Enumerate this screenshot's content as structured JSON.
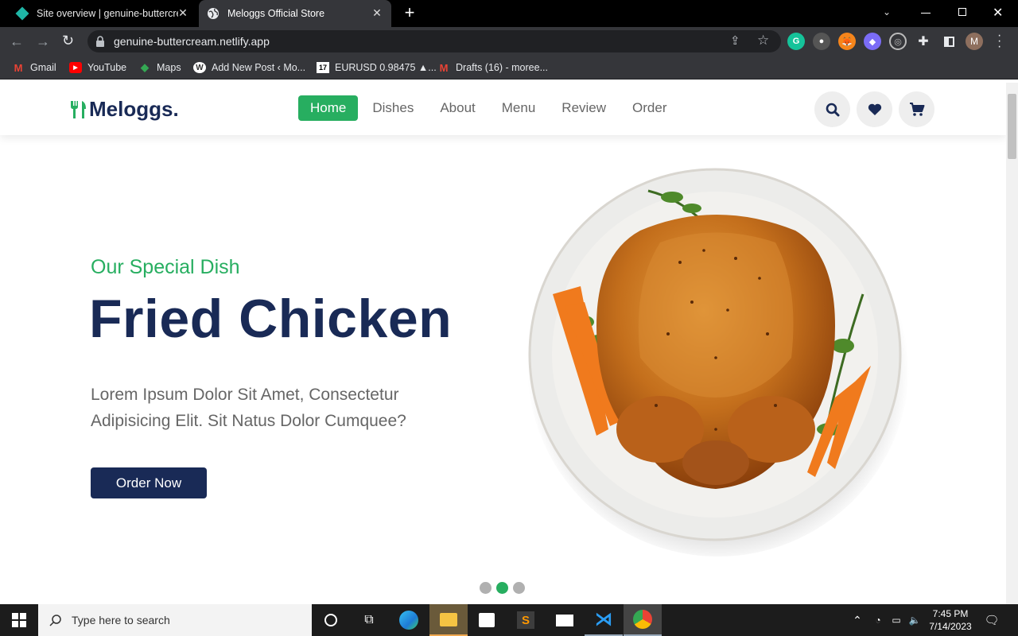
{
  "browser": {
    "tabs": [
      {
        "title": "Site overview | genuine-buttercre",
        "active": false
      },
      {
        "title": "Meloggs Official Store",
        "active": true
      }
    ],
    "url": "genuine-buttercream.netlify.app",
    "bookmarks": [
      "Gmail",
      "YouTube",
      "Maps",
      "Add New Post ‹ Mo...",
      "EURUSD 0.98475 ▲...",
      "Drafts (16) - moree..."
    ],
    "profile_initial": "M"
  },
  "site": {
    "logo": "Meloggs.",
    "nav": [
      "Home",
      "Dishes",
      "About",
      "Menu",
      "Review",
      "Order"
    ],
    "active_nav": "Home"
  },
  "hero": {
    "subtitle": "Our Special Dish",
    "title": "Fried Chicken",
    "description": "Lorem Ipsum Dolor Sit Amet, Consectetur Adipisicing Elit. Sit Natus Dolor Cumquee?",
    "button": "Order Now",
    "slide_count": 3,
    "active_slide": 2
  },
  "taskbar": {
    "search_placeholder": "Type here to search",
    "time": "7:45 PM",
    "date": "7/14/2023"
  },
  "colors": {
    "green": "#27ae60",
    "navy": "#192a56"
  }
}
